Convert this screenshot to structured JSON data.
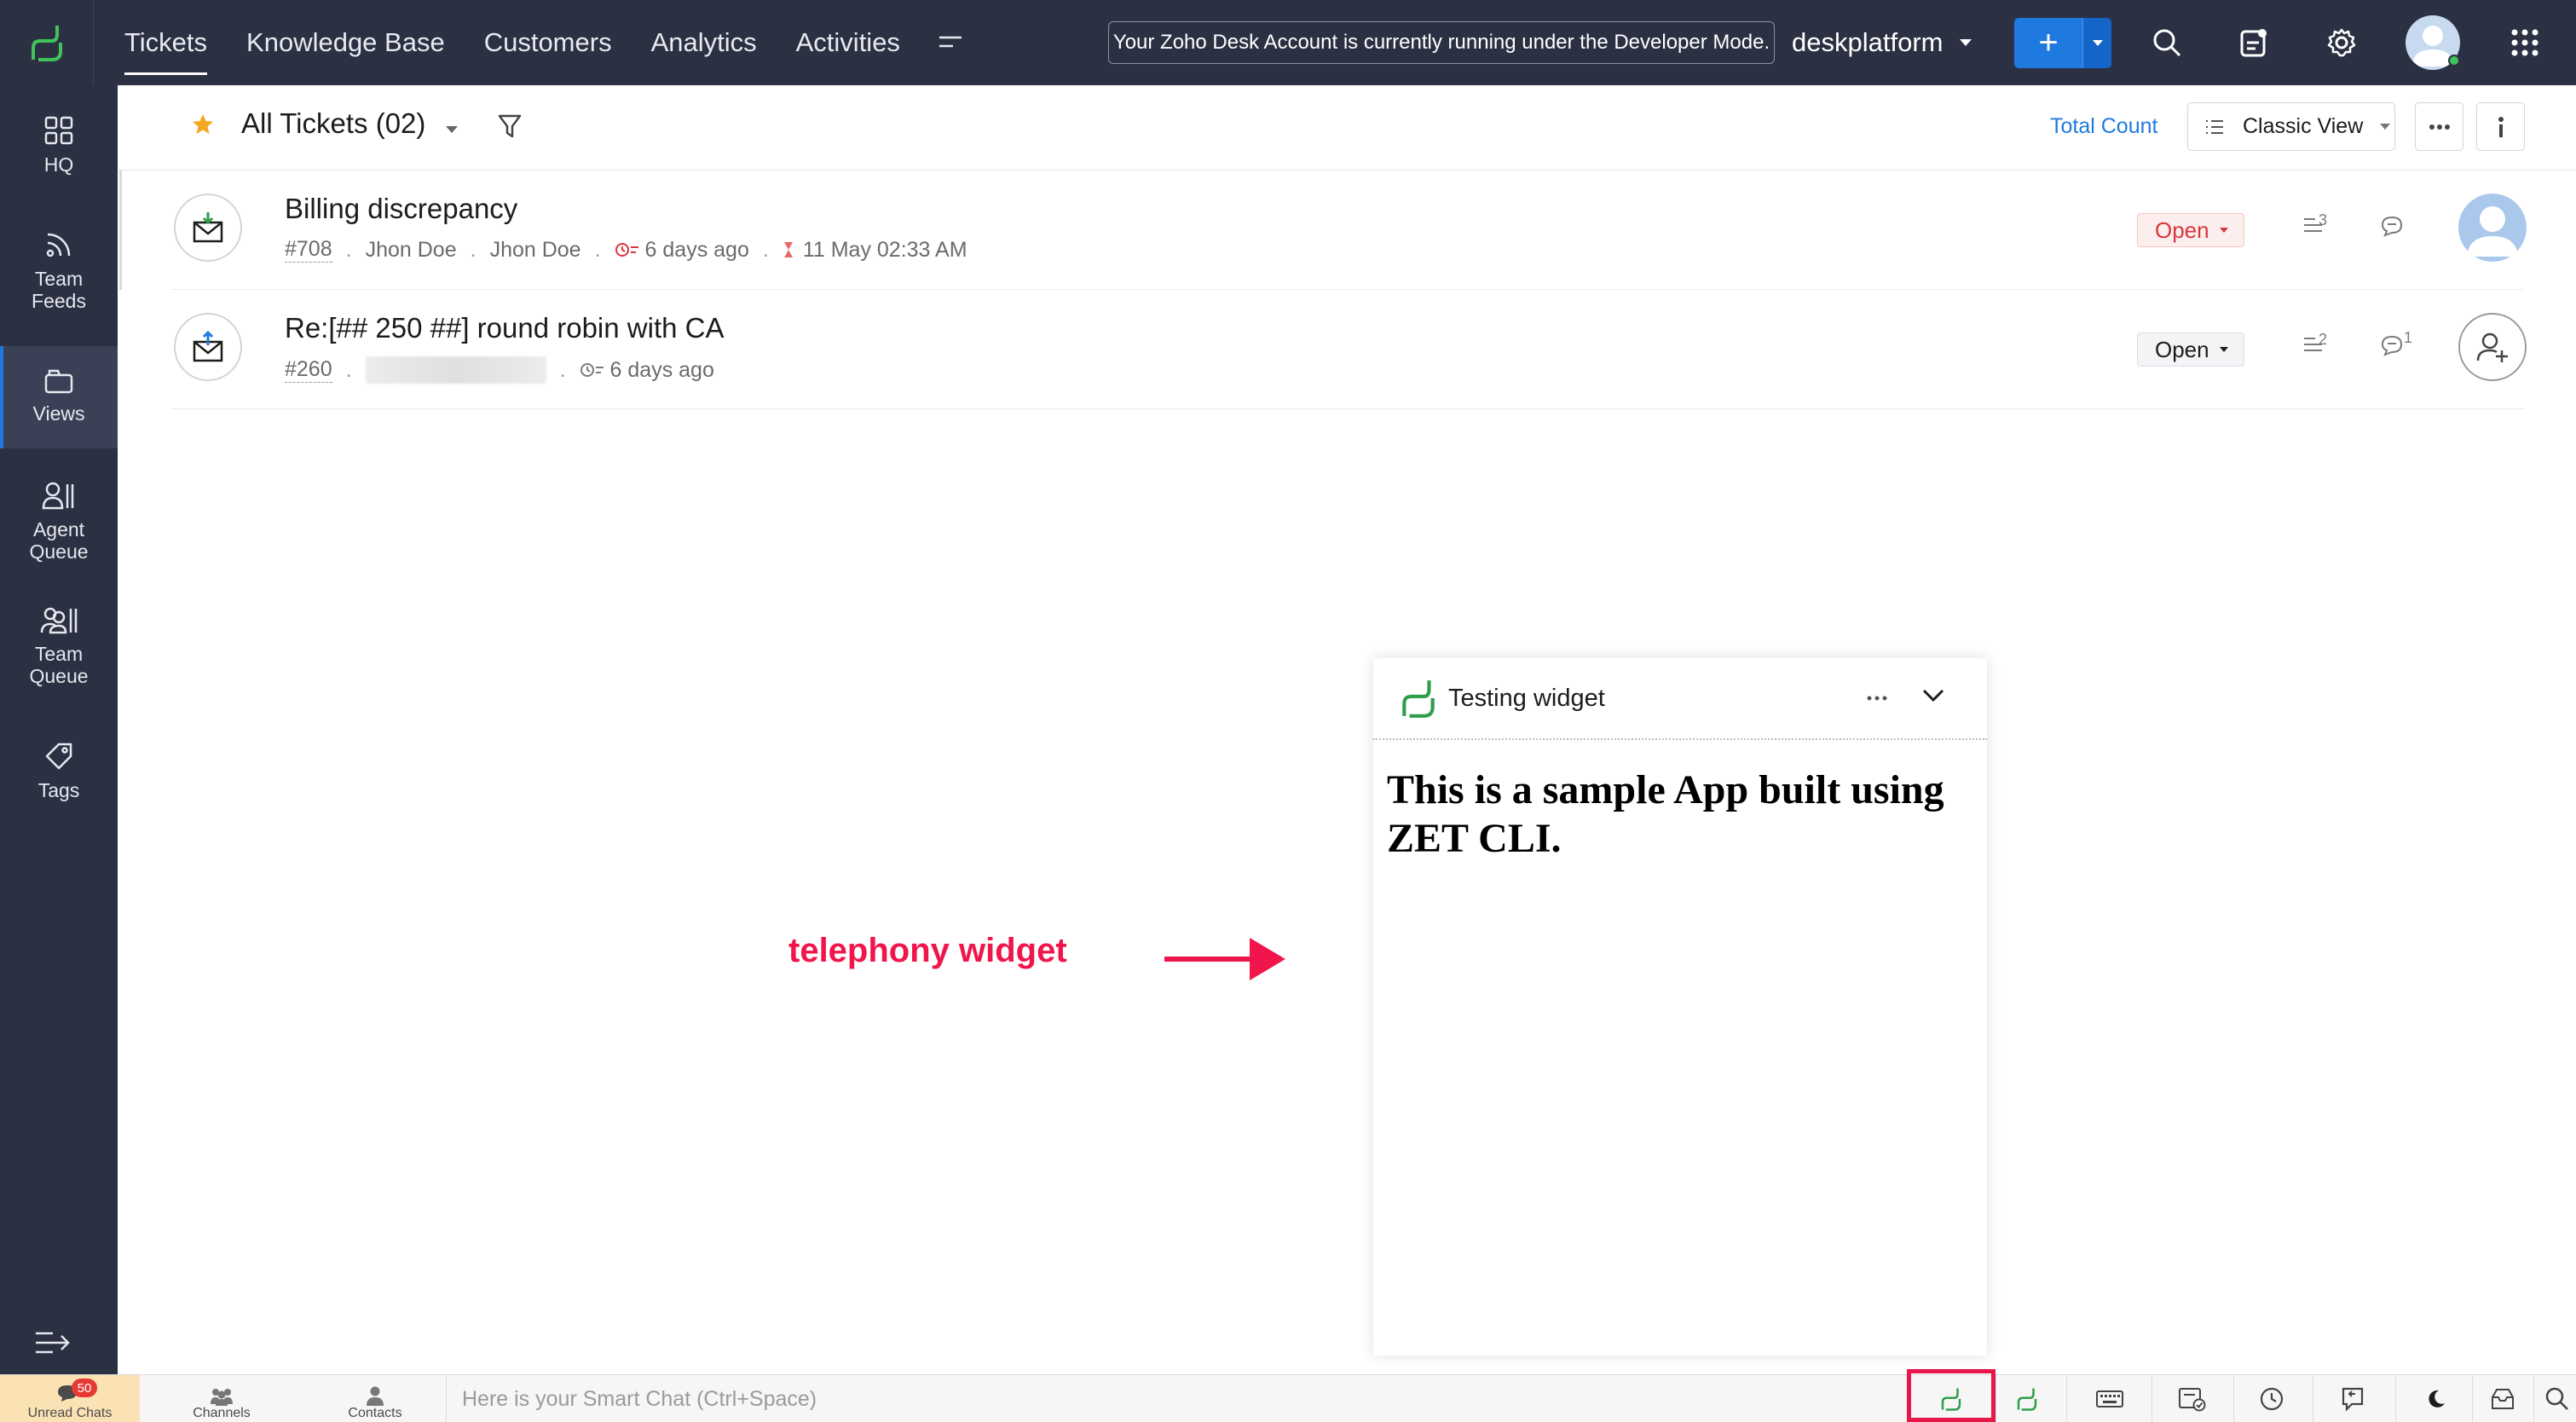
{
  "topbar": {
    "tabs": [
      {
        "label": "Tickets",
        "active": true
      },
      {
        "label": "Knowledge Base",
        "active": false
      },
      {
        "label": "Customers",
        "active": false
      },
      {
        "label": "Analytics",
        "active": false
      },
      {
        "label": "Activities",
        "active": false
      }
    ],
    "dev_banner": "Your Zoho Desk Account is currently running under the Developer Mode.",
    "portal_name": "deskplatform",
    "icons": [
      "desk-logo-icon",
      "more-tabs-icon",
      "plus-icon",
      "search-icon",
      "notifications-icon",
      "gear-icon",
      "avatar",
      "apps-grid-icon"
    ],
    "accent_color": "#1f7ae0",
    "bar_color": "#2b3142"
  },
  "sidebar": {
    "items": [
      {
        "label": "HQ",
        "icon": "grid-icon"
      },
      {
        "label": "Team Feeds",
        "icon": "feeds-icon"
      },
      {
        "label": "Views",
        "icon": "views-icon",
        "active": true
      },
      {
        "label": "Agent Queue",
        "icon": "agent-queue-icon"
      },
      {
        "label": "Team Queue",
        "icon": "team-queue-icon"
      },
      {
        "label": "Tags",
        "icon": "tag-icon"
      }
    ]
  },
  "list": {
    "view_title": "All Tickets (02)",
    "total_count_label": "Total Count",
    "view_mode": "Classic View"
  },
  "tickets": [
    {
      "subject": "Billing discrepancy",
      "number": "#708",
      "contact": "Jhon Doe",
      "account": "Jhon Doe",
      "age": "6 days ago",
      "due": "11 May 02:33 AM",
      "status": "Open",
      "thread_count": "3",
      "comment_count": "",
      "status_color": "#d8363c"
    },
    {
      "subject": "Re:[## 250 ##] round robin with CA",
      "number": "#260",
      "age": "6 days ago",
      "status": "Open",
      "thread_count": "2",
      "comment_count": "1"
    }
  ],
  "annotation": {
    "label": "telephony widget",
    "color": "#f0164c"
  },
  "widget": {
    "title": "Testing widget",
    "body": "This is a sample App built using ZET CLI."
  },
  "bottombar": {
    "unread_label": "Unread Chats",
    "unread_count": "50",
    "channels_label": "Channels",
    "contacts_label": "Contacts",
    "smart_chat_placeholder": "Here is your Smart Chat (Ctrl+Space)"
  }
}
